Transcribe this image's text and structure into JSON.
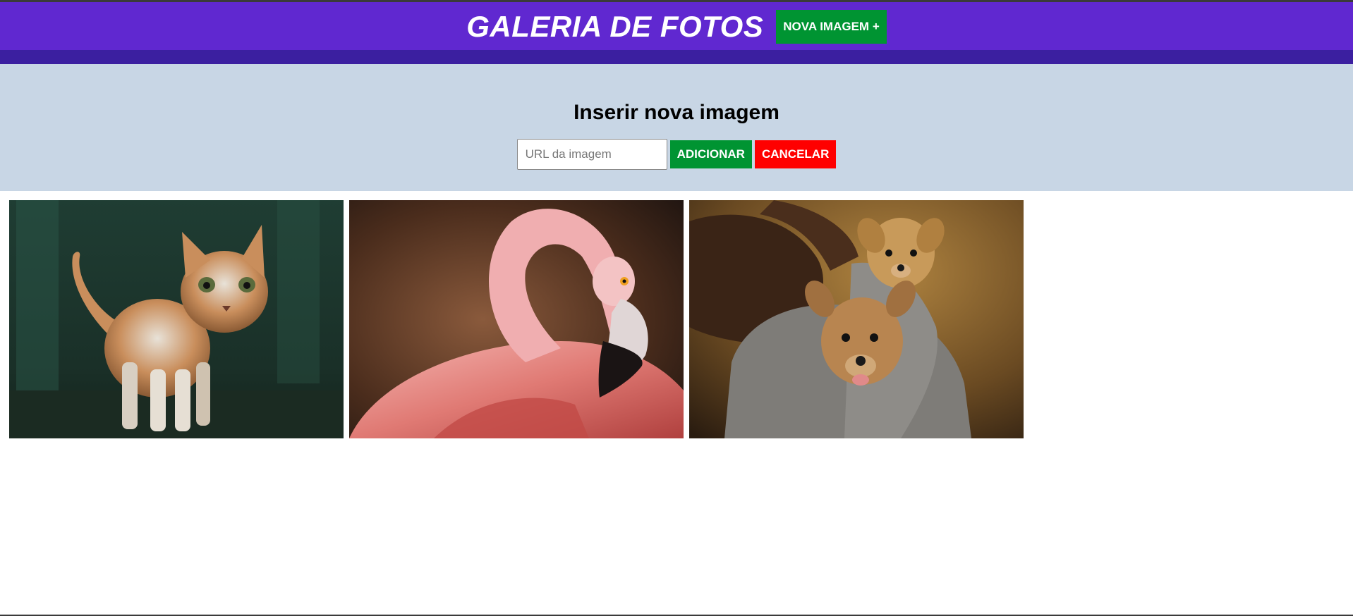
{
  "header": {
    "title": "GALERIA DE FOTOS",
    "new_image_label": "NOVA IMAGEM +"
  },
  "form": {
    "title": "Inserir nova imagem",
    "url_placeholder": "URL da imagem",
    "url_value": "",
    "add_label": "ADICIONAR",
    "cancel_label": "CANCELAR"
  },
  "gallery": {
    "photos": [
      {
        "subject": "cat"
      },
      {
        "subject": "flamingo"
      },
      {
        "subject": "puppies"
      }
    ]
  },
  "colors": {
    "header_bg": "#6028d0",
    "header_bar": "#3b1fa0",
    "form_bg": "#c8d6e5",
    "green": "#009432",
    "red": "#ff0000"
  }
}
